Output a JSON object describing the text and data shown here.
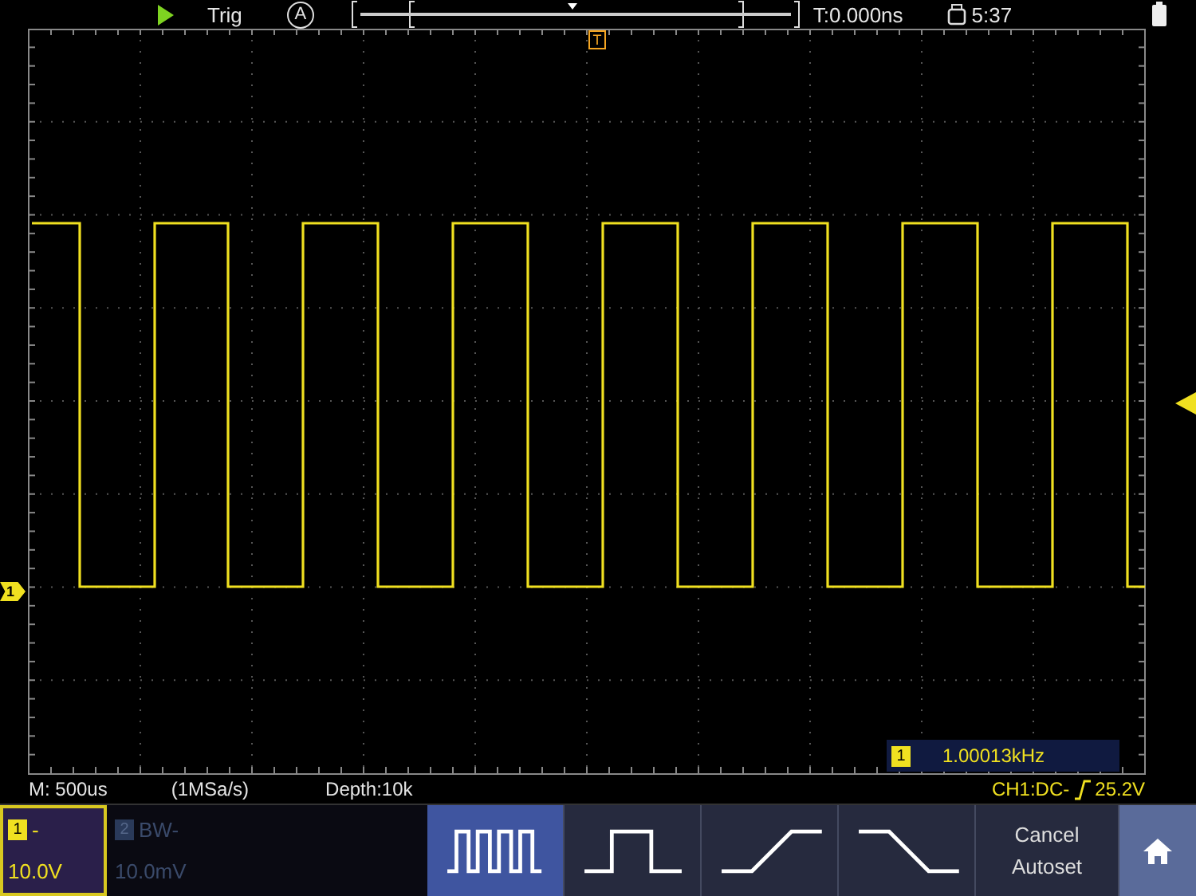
{
  "top_bar": {
    "trigger_label": "Trig",
    "trigger_mode": "A",
    "time_offset": "T:0.000ns",
    "clock": "5:37"
  },
  "plot": {
    "trigger_marker": "T",
    "channel_marker": "1",
    "measurement": {
      "channel": "1",
      "value": "1.00013kHz"
    }
  },
  "status_bar": {
    "timebase": "M: 500us",
    "sample_rate": "(1MSa/s)",
    "depth": "Depth:10k",
    "trigger_source": "CH1:DC-",
    "trigger_level": "25.2V"
  },
  "channels": [
    {
      "badge": "1",
      "coupling": "-",
      "scale": "10.0V",
      "selected": true,
      "enabled": true
    },
    {
      "badge": "2",
      "coupling": "BW-",
      "scale": "10.0mV",
      "selected": false,
      "enabled": false
    }
  ],
  "soft_keys": [
    {
      "kind": "pulses",
      "selected": true
    },
    {
      "kind": "pulse",
      "selected": false
    },
    {
      "kind": "rise",
      "selected": false
    },
    {
      "kind": "fall",
      "selected": false
    },
    {
      "kind": "text",
      "selected": false,
      "lines": [
        "Cancel",
        "Autoset"
      ]
    }
  ]
}
